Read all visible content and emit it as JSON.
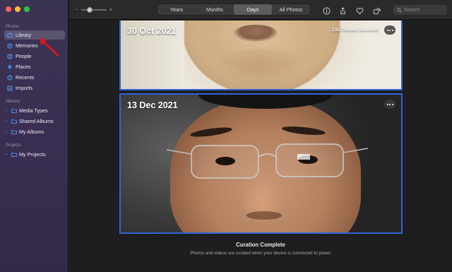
{
  "sidebar": {
    "photos_section": "Photos",
    "photos_items": [
      {
        "label": "Library",
        "icon": "library-icon",
        "active": true
      },
      {
        "label": "Memories",
        "icon": "memories-icon"
      },
      {
        "label": "People",
        "icon": "people-icon"
      },
      {
        "label": "Places",
        "icon": "places-icon"
      },
      {
        "label": "Recents",
        "icon": "recents-icon"
      },
      {
        "label": "Imports",
        "icon": "imports-icon"
      }
    ],
    "albums_section": "Albums",
    "albums_items": [
      {
        "label": "Media Types",
        "icon": "folder-icon"
      },
      {
        "label": "Shared Albums",
        "icon": "folder-icon"
      },
      {
        "label": "My Albums",
        "icon": "folder-icon"
      }
    ],
    "projects_section": "Projects",
    "projects_items": [
      {
        "label": "My Projects",
        "icon": "folder-icon"
      }
    ]
  },
  "toolbar": {
    "zoom_minus": "−",
    "zoom_plus": "+",
    "zoom_level": 0.2,
    "views": [
      "Years",
      "Months",
      "Days",
      "All Photos"
    ],
    "selected_view": "Days",
    "search_placeholder": "Search"
  },
  "cards": [
    {
      "date": "30 Oct 2021",
      "selection": "132 Photos Selected"
    },
    {
      "date": "13 Dec 2021",
      "selection": ""
    }
  ],
  "footer": {
    "title": "Curation Complete",
    "text": "Photos and videos are curated when your device is connected to power"
  },
  "colors": {
    "accent": "#2f64d8",
    "sidebar_icon": "#4ea2ff",
    "annotation_arrow": "#e8151b"
  }
}
